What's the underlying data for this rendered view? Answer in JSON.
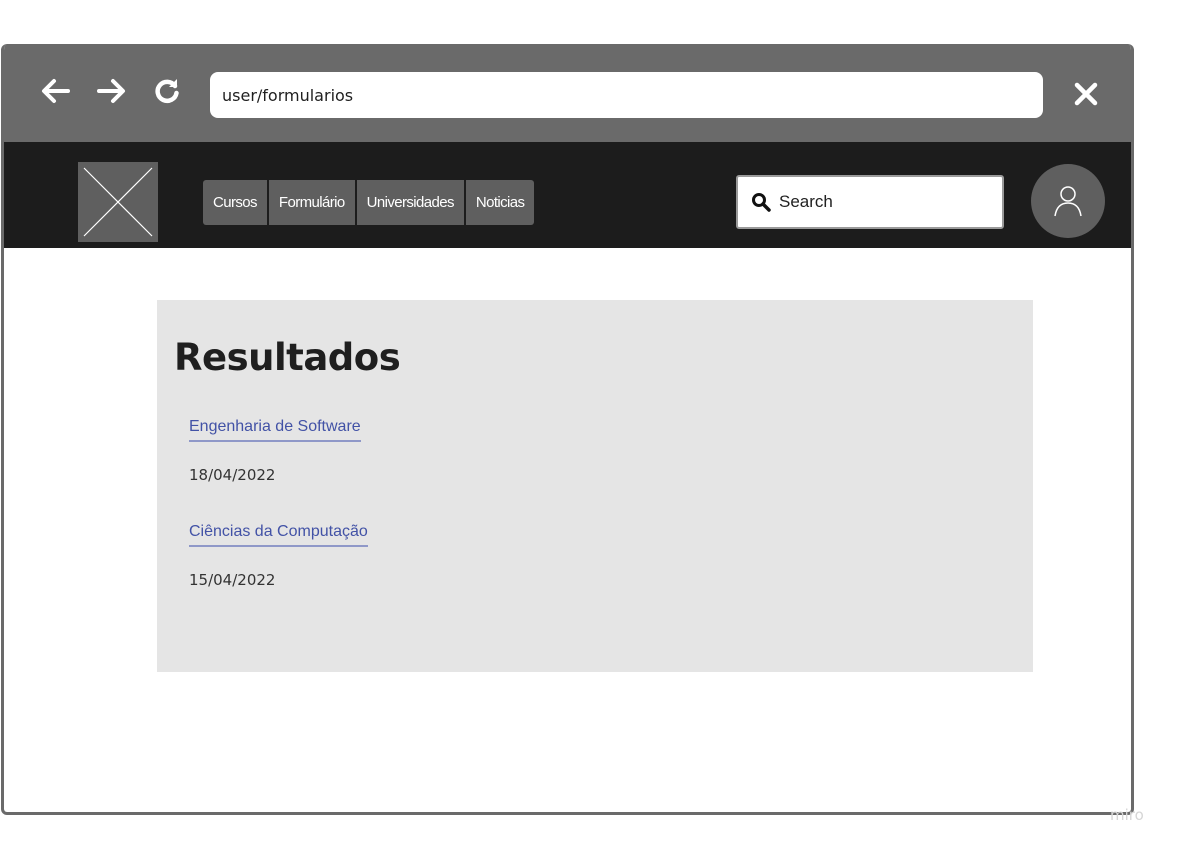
{
  "browser": {
    "url": "user/formularios"
  },
  "nav": {
    "items": [
      {
        "label": "Cursos"
      },
      {
        "label": "Formulário"
      },
      {
        "label": "Universidades"
      },
      {
        "label": "Noticias"
      }
    ],
    "search_label": "Search"
  },
  "results": {
    "title": "Resultados",
    "items": [
      {
        "name": "Engenharia de Software",
        "date": "18/04/2022"
      },
      {
        "name": "Ciências da Computação",
        "date": "15/04/2022"
      }
    ]
  },
  "watermark": "miro",
  "colors": {
    "browser_bar": "#6a6a6a",
    "header": "#1c1c1c",
    "menu_item": "#5f5f5f",
    "panel": "#e5e5e5",
    "link": "#4252a6"
  }
}
